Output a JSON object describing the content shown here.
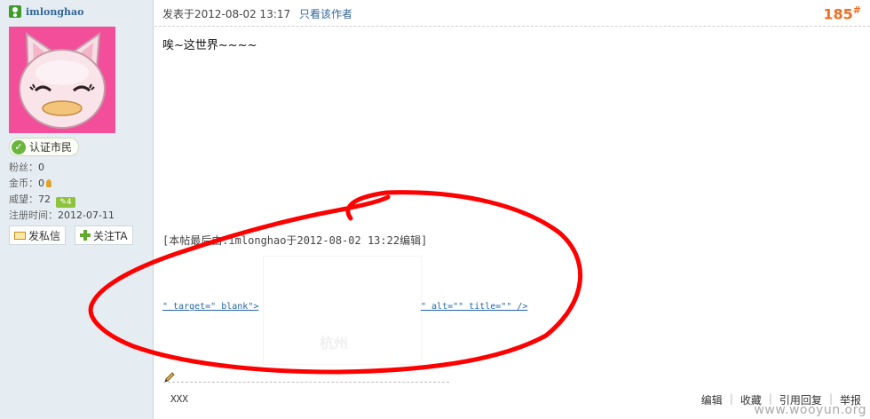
{
  "user": {
    "name": "imlonghao",
    "badge": "认证市民",
    "stats": [
      {
        "label": "粉丝：",
        "value": "0"
      },
      {
        "label": "金币：",
        "value": "0"
      },
      {
        "label": "威望：",
        "value": "72"
      },
      {
        "label": "注册时间：",
        "value": "2012-07-11"
      }
    ],
    "level_badge": "4",
    "buttons": {
      "message": "发私信",
      "follow": "关注TA"
    }
  },
  "post": {
    "posted": "发表于2012-08-02 13:17",
    "author_only": "只看该作者",
    "floor": "185",
    "floor_mark": "#",
    "body": "唉~这世界~~~~",
    "edit_note": "[本帖最后由:imlonghao于2012-08-02 13:22编辑]",
    "fragment_left": "\" target=\" blank\">",
    "fragment_right": "\" alt=\"\" title=\"\" />",
    "image_caption": "杭州",
    "signature": "XXX",
    "actions": [
      "编辑",
      "收藏",
      "引用回复",
      "举报"
    ]
  },
  "watermark": "www.wooyun.org",
  "colors": {
    "accent": "#f26c20",
    "link": "#336699",
    "annotation": "#ff0000",
    "sidebar": "#e5edf2"
  },
  "icons": [
    "user-icon",
    "check-icon",
    "coin-icon",
    "level-icon",
    "mail-icon",
    "plus-icon",
    "pencil-icon"
  ]
}
